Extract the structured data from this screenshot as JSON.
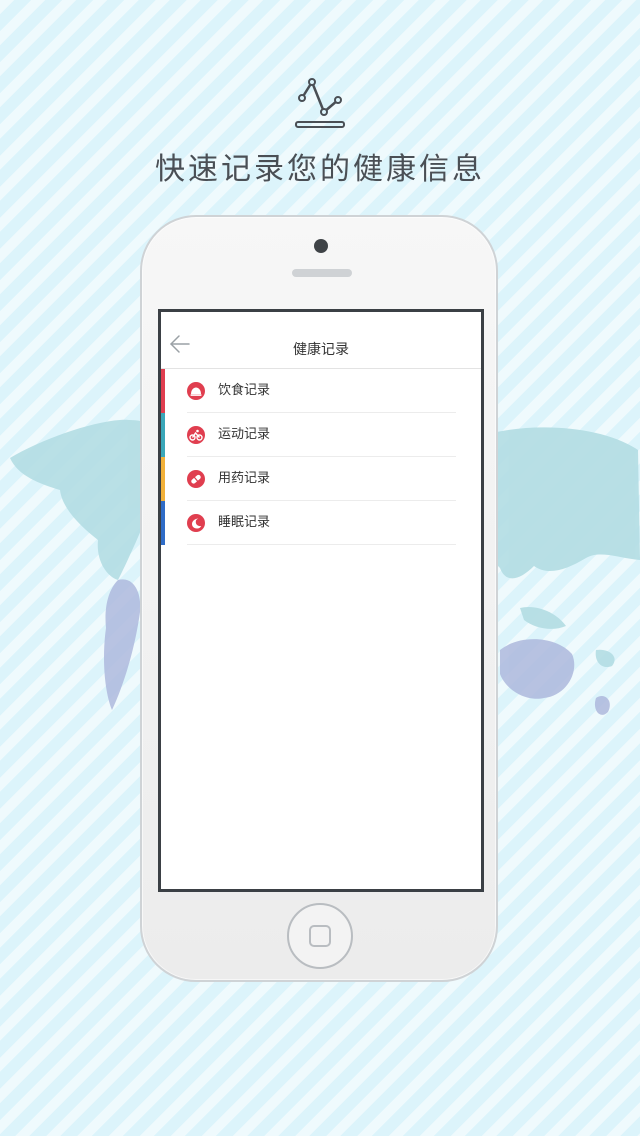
{
  "promo": {
    "tagline": "快速记录您的健康信息",
    "logo_icon": "line-chart-stand-icon"
  },
  "app": {
    "header_title": "健康记录",
    "back_icon": "arrow-left-icon",
    "menu": [
      {
        "label": "饮食记录",
        "icon": "food-dish-icon",
        "accent": "#e03e4f"
      },
      {
        "label": "运动记录",
        "icon": "bicycle-icon",
        "accent": "#3aa7b9"
      },
      {
        "label": "用药记录",
        "icon": "pill-icon",
        "accent": "#f2b13a"
      },
      {
        "label": "睡眠记录",
        "icon": "moon-icon",
        "accent": "#2f6cc7"
      }
    ],
    "icon_color": "#e03e4f"
  },
  "colors": {
    "background": "#dcf4fb",
    "phone_body": "#f2f2f2",
    "screen_border": "#3b4045"
  }
}
